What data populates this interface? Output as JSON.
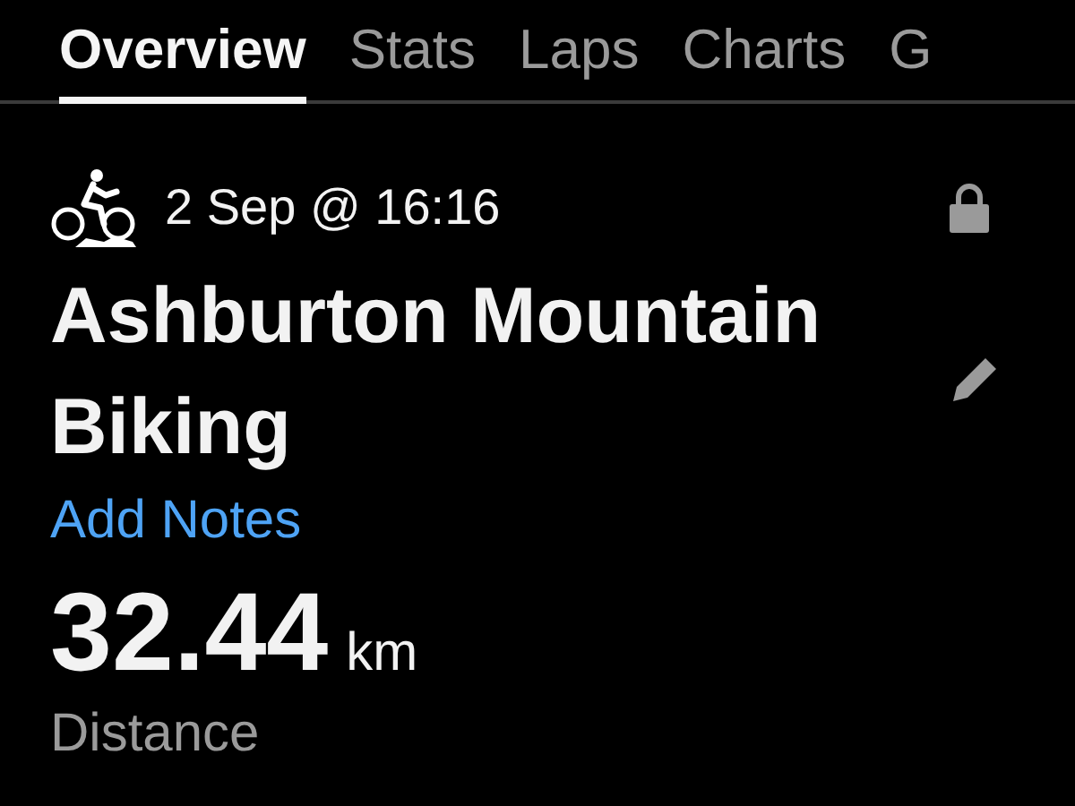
{
  "tabs": [
    {
      "label": "Overview",
      "selected": true
    },
    {
      "label": "Stats",
      "selected": false
    },
    {
      "label": "Laps",
      "selected": false
    },
    {
      "label": "Charts",
      "selected": false
    },
    {
      "label": "G",
      "selected": false
    }
  ],
  "activity": {
    "date": "2 Sep @ 16:16",
    "locked": true,
    "title": "Ashburton Mountain Biking",
    "notes_link": "Add Notes"
  },
  "metric": {
    "value": "32.44",
    "unit": "km",
    "label": "Distance"
  }
}
